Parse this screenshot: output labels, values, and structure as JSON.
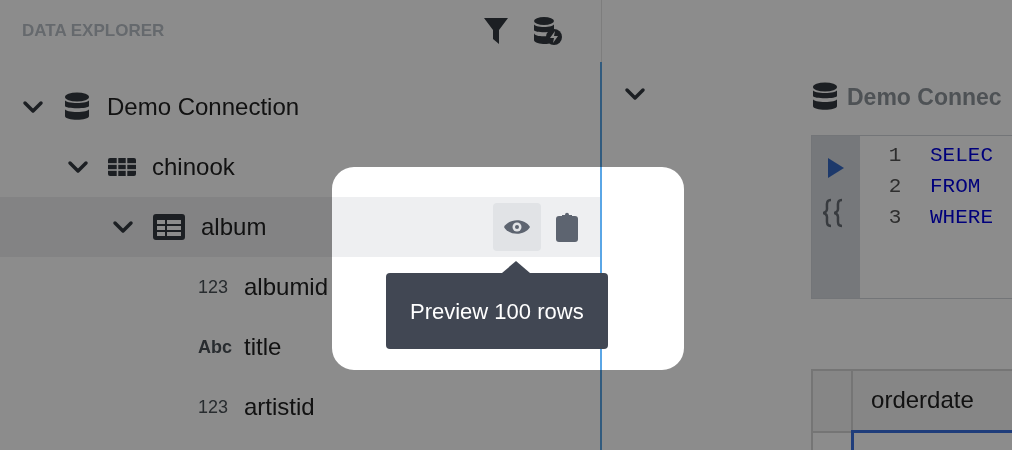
{
  "sidebar": {
    "title": "DATA EXPLORER",
    "tree": [
      {
        "label": "Demo Connection",
        "kind": "connection",
        "expanded": true,
        "selected": false,
        "children": [
          {
            "label": "chinook",
            "kind": "schema",
            "expanded": true,
            "selected": false,
            "children": [
              {
                "label": "album",
                "kind": "table",
                "expanded": true,
                "selected": true,
                "children": [
                  {
                    "label": "albumid",
                    "kind": "column",
                    "type": "123",
                    "selected": false
                  },
                  {
                    "label": "title",
                    "kind": "column",
                    "type": "Abc",
                    "selected": false
                  },
                  {
                    "label": "artistid",
                    "kind": "column",
                    "type": "123",
                    "selected": false
                  }
                ]
              }
            ]
          }
        ]
      }
    ]
  },
  "tooltip": {
    "text": "Preview 100 rows"
  },
  "editor": {
    "title": "Demo Connec",
    "lines": [
      {
        "number": "1",
        "code": "SELEC"
      },
      {
        "number": "2",
        "code": "FROM"
      },
      {
        "number": "3",
        "code": "WHERE"
      }
    ]
  },
  "results": {
    "columns": [
      "orderdate"
    ]
  }
}
